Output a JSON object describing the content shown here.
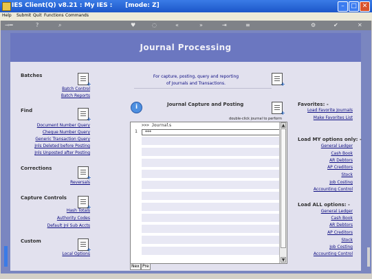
{
  "window": {
    "title": "IES Client(Q) v8.21 : My IES :      [mode: Z]"
  },
  "menubar": {
    "items": [
      "Help",
      "Submit",
      "Quit",
      "Functions",
      "Commands"
    ]
  },
  "banner": {
    "title": "Journal Processing"
  },
  "left": {
    "batches": {
      "heading": "Batches",
      "links": [
        "Batch Control",
        "Batch Reports"
      ]
    },
    "find": {
      "heading": "Find",
      "links": [
        "Document Number Query",
        "Cheque Number Query",
        "Generic Transaction Query",
        "Jnls Deleted before Posting",
        "Jnls Unposted after Posting"
      ]
    },
    "corrections": {
      "heading": "Corrections",
      "links": [
        "Reversals"
      ]
    },
    "capture_controls": {
      "heading": "Capture Controls",
      "links": [
        "Hash Totals",
        "Authority Codes",
        "Default Jnl Sub Accts"
      ]
    },
    "custom": {
      "heading": "Custom",
      "links": [
        "Local Options"
      ]
    }
  },
  "center": {
    "intro_line1": "For capture, posting, query and reporting",
    "intro_line2": "of Journals and Transactions.",
    "section_title": "Journal Capture and Posting",
    "hint": "double-click journal to perform",
    "grid": {
      "header": ">>> Journals",
      "row_number": "1",
      "first_row_value": "***"
    },
    "nav": {
      "next": "Nex",
      "prev": "Pre"
    }
  },
  "right": {
    "favorites": {
      "heading": "Favorites: -",
      "links": [
        "Load Favorite Journals",
        "Make Favorites List"
      ]
    },
    "load_my": {
      "heading": "Load MY options only: -",
      "links": [
        "General Ledger",
        "Cash Book",
        "AR Debtors",
        "AP Creditors",
        "Stock",
        "Job Costing",
        "Accounting Control"
      ]
    },
    "load_all": {
      "heading": "Load ALL options: -",
      "links": [
        "General Ledger",
        "Cash Book",
        "AR Debtors",
        "AP Creditors",
        "Stock",
        "Job Costing",
        "Accounting Control"
      ]
    }
  },
  "colors": {
    "titlebar": "#1c56c9",
    "stage": "#7a86c0",
    "banner": "#6b77c0",
    "panel": "#e2e1ee",
    "link": "#0a0a80"
  }
}
